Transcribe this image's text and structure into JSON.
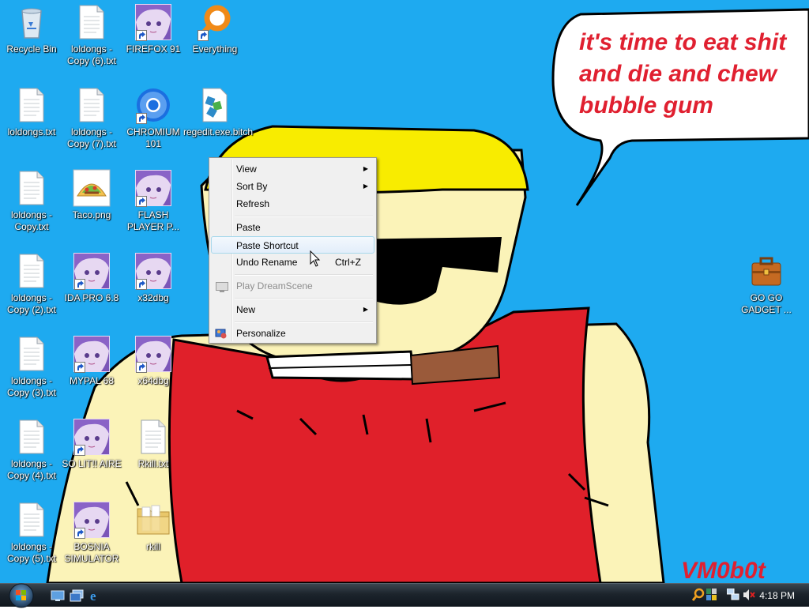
{
  "wallpaper": {
    "speech_lines": [
      "it's time to eat shit",
      "and die and chew",
      "bubble gum"
    ],
    "signature": "VM0b0t",
    "colors": {
      "sky": "#1eaaf0",
      "hair": "#f8ec00",
      "skin": "#fbf3b8",
      "shirt": "#e0202a",
      "speech_text": "#e02030"
    }
  },
  "desktop_icons": [
    {
      "label": "Recycle Bin",
      "icon": "recycle-bin"
    },
    {
      "label": "loldongs - Copy (6).txt",
      "icon": "text-file"
    },
    {
      "label": "FIREFOX 91",
      "icon": "anime-shortcut"
    },
    {
      "label": "Everything",
      "icon": "everything-search"
    },
    {
      "label": "loldongs.txt",
      "icon": "text-file"
    },
    {
      "label": "loldongs - Copy (7).txt",
      "icon": "text-file"
    },
    {
      "label": "CHROMIUM 101",
      "icon": "chromium"
    },
    {
      "label": "regedit.exe.bitch",
      "icon": "regedit"
    },
    {
      "label": "loldongs - Copy.txt",
      "icon": "text-file"
    },
    {
      "label": "Taco.png",
      "icon": "taco-image"
    },
    {
      "label": "FLASH PLAYER P...",
      "icon": "anime-shortcut"
    },
    {
      "label": "loldongs - Copy (2).txt",
      "icon": "text-file"
    },
    {
      "label": "IDA PRO 6.8",
      "icon": "anime-shortcut"
    },
    {
      "label": "x32dbg",
      "icon": "anime-shortcut"
    },
    {
      "label": "loldongs - Copy (3).txt",
      "icon": "text-file"
    },
    {
      "label": "MYPAL 68",
      "icon": "anime-shortcut"
    },
    {
      "label": "x64dbg",
      "icon": "anime-shortcut"
    },
    {
      "label": "loldongs - Copy (4).txt",
      "icon": "text-file"
    },
    {
      "label": "SO LIT!! AIRE",
      "icon": "anime-shortcut"
    },
    {
      "label": "Rkill.txt",
      "icon": "text-file"
    },
    {
      "label": "loldongs - Copy (5).txt",
      "icon": "text-file"
    },
    {
      "label": "BOSNIA SIMULATOR",
      "icon": "anime-shortcut"
    },
    {
      "label": "rkill",
      "icon": "folder"
    },
    {
      "label": "GO GO GADGET ...",
      "icon": "briefcase"
    }
  ],
  "context_menu": {
    "view": "View",
    "sort_by": "Sort By",
    "refresh": "Refresh",
    "paste": "Paste",
    "paste_shortcut": "Paste Shortcut",
    "undo_rename": "Undo Rename",
    "undo_rename_shortcut": "Ctrl+Z",
    "play_dreamscene": "Play DreamScene",
    "new": "New",
    "personalize": "Personalize",
    "highlighted": "Paste Shortcut"
  },
  "taskbar": {
    "clock": "4:18 PM",
    "quick_launch": [
      "show-desktop",
      "switch-windows",
      "internet-explorer"
    ]
  }
}
